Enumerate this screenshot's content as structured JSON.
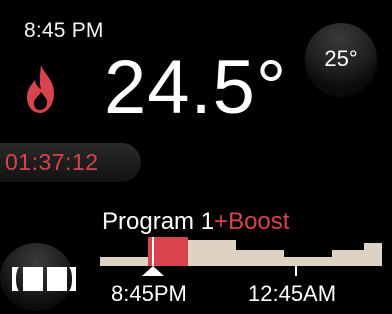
{
  "status": {
    "clock": "8:45 PM",
    "current_temperature": "24.5°",
    "boost_timer": "01:37:12"
  },
  "controls": {
    "setpoint_label": "25°",
    "menu_icon": "menu-icon"
  },
  "program": {
    "name": "Program 1",
    "boost": "+Boost",
    "timeline_labels": [
      "8:45PM",
      "12:45AM"
    ],
    "schedule_levels": [
      0.3,
      1,
      0.88,
      0.55,
      0.3,
      0.55,
      0.79,
      1
    ]
  },
  "colors": {
    "boost": "#d9434d",
    "timeline": "#ded2c2",
    "background": "#000000"
  }
}
